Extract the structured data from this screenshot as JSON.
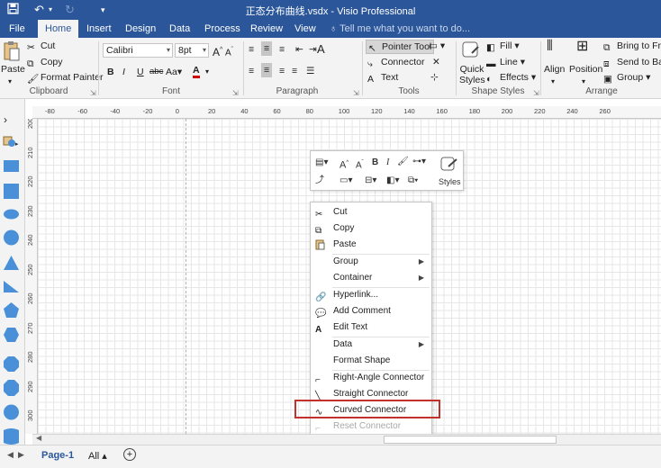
{
  "window": {
    "title": "正态分布曲线.vsdx - Visio Professional"
  },
  "tabs": [
    "File",
    "Home",
    "Insert",
    "Design",
    "Data",
    "Process",
    "Review",
    "View"
  ],
  "active_tab": "Home",
  "tell_me": "Tell me what you want to do...",
  "clipboard": {
    "paste": "Paste",
    "cut": "Cut",
    "copy": "Copy",
    "format_painter": "Format Painter",
    "label": "Clipboard"
  },
  "font": {
    "family": "Calibri",
    "size": "8pt",
    "label": "Font"
  },
  "paragraph": {
    "label": "Paragraph"
  },
  "tools": {
    "pointer": "Pointer Tool",
    "connector": "Connector",
    "text": "Text",
    "label": "Tools"
  },
  "shape_styles": {
    "quick_styles": "Quick Styles",
    "fill": "Fill",
    "line": "Line",
    "effects": "Effects",
    "label": "Shape Styles"
  },
  "arrange": {
    "align": "Align",
    "position": "Position",
    "bring_to_front": "Bring to Fron",
    "send_to_back": "Send to Back",
    "group": "Group",
    "label": "Arrange"
  },
  "ruler": {
    "horizontal": [
      "-80",
      "-60",
      "-40",
      "-20",
      "0",
      "20",
      "40",
      "60",
      "80",
      "100",
      "120",
      "140",
      "160",
      "180",
      "200",
      "220",
      "240",
      "260"
    ],
    "vertical": [
      "300",
      "290",
      "280",
      "270",
      "260",
      "250",
      "240",
      "230",
      "220",
      "210",
      "200"
    ]
  },
  "mini_toolbar": {
    "styles": "Styles"
  },
  "context_menu": {
    "items": [
      {
        "label": "Cut",
        "icon": "scissors-icon"
      },
      {
        "label": "Copy",
        "icon": "copy-icon"
      },
      {
        "label": "Paste",
        "icon": "paste-icon"
      },
      {
        "label": "Group",
        "submenu": true
      },
      {
        "label": "Container",
        "submenu": true
      },
      {
        "label": "Hyperlink...",
        "icon": "hyperlink-icon"
      },
      {
        "label": "Add Comment",
        "icon": "comment-icon"
      },
      {
        "label": "Edit Text",
        "icon": "edit-text-icon"
      },
      {
        "label": "Data",
        "submenu": true
      },
      {
        "label": "Format Shape"
      },
      {
        "label": "Right-Angle Connector",
        "icon": "right-angle-connector-icon"
      },
      {
        "label": "Straight Connector",
        "icon": "straight-connector-icon"
      },
      {
        "label": "Curved Connector",
        "icon": "curved-connector-icon",
        "highlighted": true
      },
      {
        "label": "Reset Connector",
        "disabled": true
      }
    ]
  },
  "status": {
    "page": "Page-1",
    "all": "All",
    "add": "+"
  },
  "colors": {
    "ribbon_blue": "#2b579a",
    "highlight_red": "#c4302b",
    "shape_blue": "#4a90d9"
  }
}
